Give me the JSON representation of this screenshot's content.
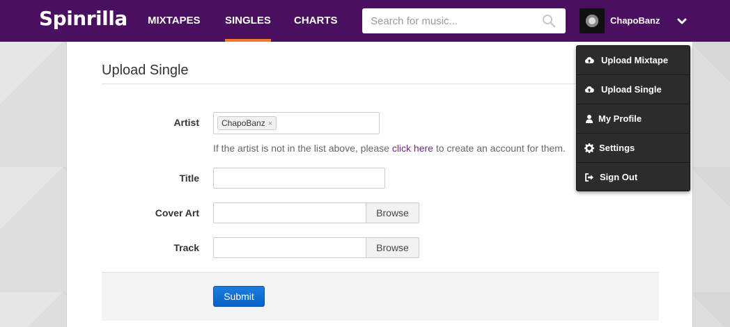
{
  "header": {
    "logo": "Spinrilla",
    "nav": [
      {
        "label": "MIXTAPES",
        "active": false
      },
      {
        "label": "SINGLES",
        "active": true
      },
      {
        "label": "CHARTS",
        "active": false
      }
    ],
    "search_placeholder": "Search for music...",
    "username": "ChapoBanz"
  },
  "dropdown": {
    "items": [
      {
        "label": "Upload Mixtape",
        "icon": "cloud-upload-icon"
      },
      {
        "label": "Upload Single",
        "icon": "cloud-upload-icon"
      },
      {
        "label": "My Profile",
        "icon": "user-icon"
      },
      {
        "label": "Settings",
        "icon": "gear-icon"
      },
      {
        "label": "Sign Out",
        "icon": "sign-out-icon"
      }
    ]
  },
  "form": {
    "title": "Upload Single",
    "artist_label": "Artist",
    "artist_tag": "ChapoBanz",
    "tag_remove": "×",
    "help_prefix": "If the artist is not in the list above, please",
    "help_link": "click here",
    "help_suffix": "to create an account for them.",
    "title_label": "Title",
    "title_value": "",
    "cover_label": "Cover Art",
    "track_label": "Track",
    "browse_label": "Browse",
    "submit_label": "Submit"
  },
  "colors": {
    "header_bg": "#4a0f5e",
    "active_underline": "#f3792a",
    "link": "#6a2b84",
    "submit": "#0a5fc4",
    "dropdown_bg": "#2c2c2c"
  }
}
